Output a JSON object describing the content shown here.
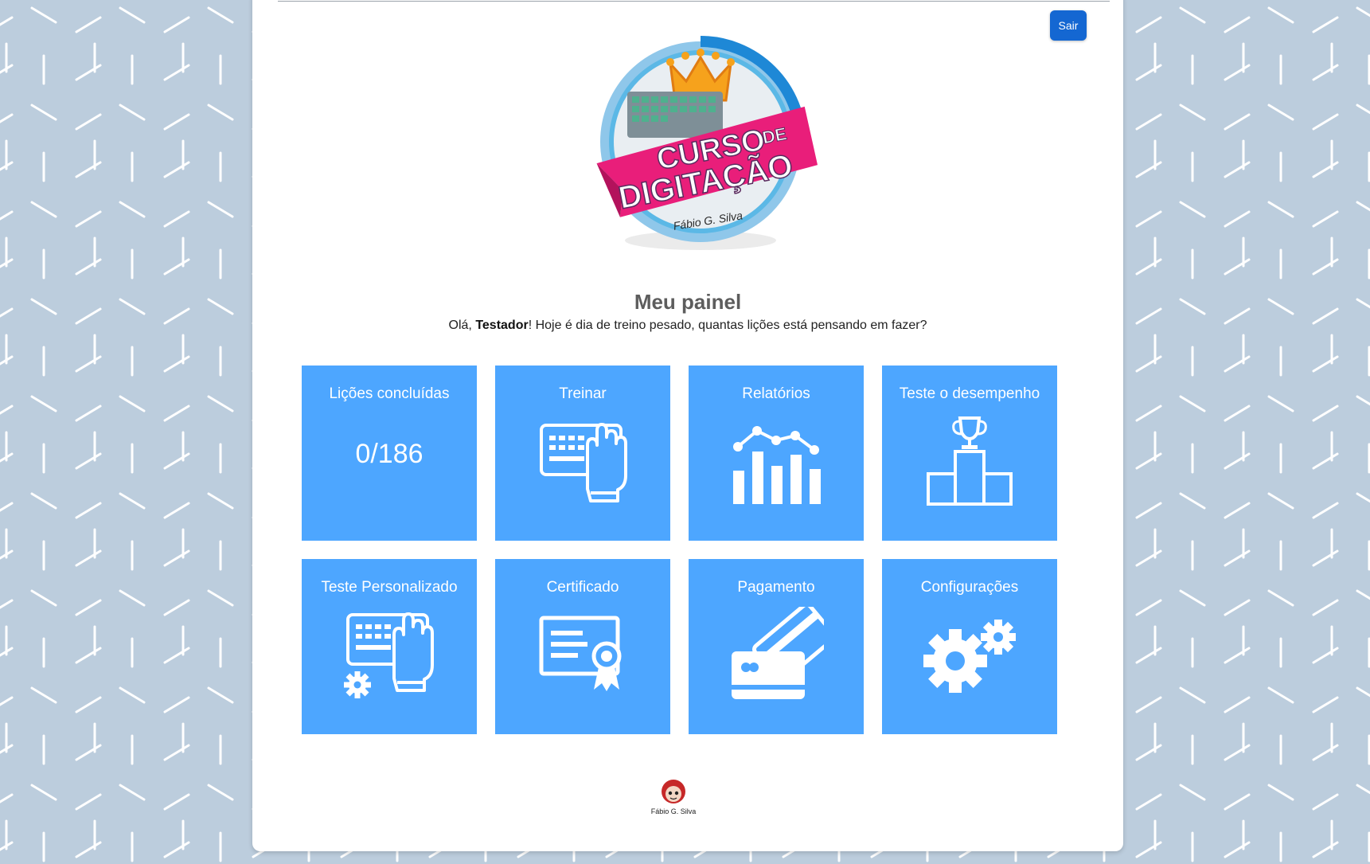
{
  "header": {
    "logout_label": "Sair"
  },
  "logo": {
    "title_line1": "CURSO",
    "title_de": "DE",
    "title_line2": "DIGITAÇÃO",
    "author": "Fábio G. Silva"
  },
  "dashboard": {
    "title": "Meu painel",
    "greeting_prefix": "Olá, ",
    "user_name": "Testador",
    "greeting_suffix": "! Hoje é dia de treino pesado, quantas lições está pensando em fazer?"
  },
  "tiles": [
    {
      "label": "Lições concluídas",
      "counter": "0/186"
    },
    {
      "label": "Treinar",
      "icon": "keyboard-hand-icon"
    },
    {
      "label": "Relatórios",
      "icon": "bar-chart-icon"
    },
    {
      "label": "Teste o desempenho",
      "icon": "trophy-podium-icon"
    },
    {
      "label": "Teste Personalizado",
      "icon": "keyboard-gear-icon"
    },
    {
      "label": "Certificado",
      "icon": "certificate-icon"
    },
    {
      "label": "Pagamento",
      "icon": "credit-card-icon"
    },
    {
      "label": "Configurações",
      "icon": "gears-icon"
    }
  ],
  "footer": {
    "brand": "Fábio G. Silva"
  },
  "colors": {
    "background": "#bccddd",
    "tile": "#4da6ff",
    "button": "#1467d2",
    "ribbon": "#e91e7a"
  }
}
